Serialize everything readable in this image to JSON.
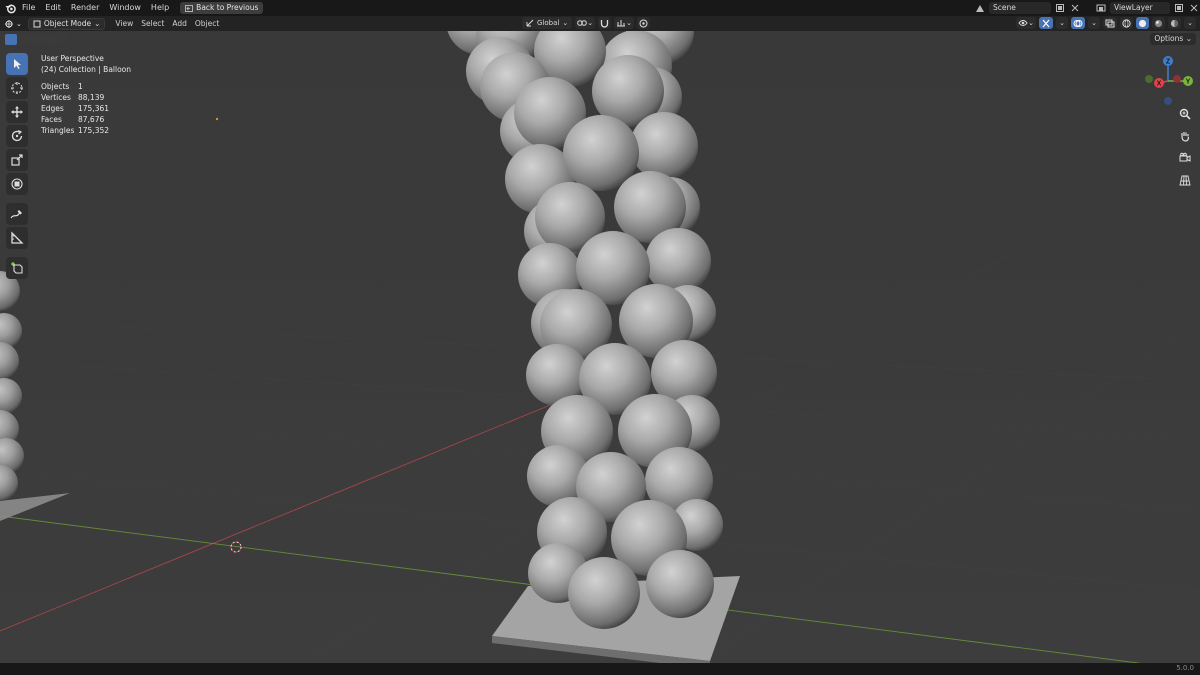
{
  "topbar": {
    "menus": [
      "File",
      "Edit",
      "Render",
      "Window",
      "Help"
    ],
    "back_button": "Back to Previous",
    "scene_label": "Scene",
    "view_layer_label": "ViewLayer"
  },
  "viewport_header": {
    "mode": "Object Mode",
    "menus": [
      "View",
      "Select",
      "Add",
      "Object"
    ],
    "orientation": "Global"
  },
  "tool_settings": {
    "options_label": "Options"
  },
  "overlay": {
    "view_name": "User Perspective",
    "collection": "(24) Collection | Balloon",
    "stats": [
      {
        "label": "Objects",
        "value": "1"
      },
      {
        "label": "Vertices",
        "value": "88,139"
      },
      {
        "label": "Edges",
        "value": "175,361"
      },
      {
        "label": "Faces",
        "value": "87,676"
      },
      {
        "label": "Triangles",
        "value": "175,352"
      }
    ]
  },
  "gizmo": {
    "x_label": "X",
    "y_label": "Y",
    "z_label": "Z"
  },
  "statusbar": {
    "version": "5.0.0"
  },
  "colors": {
    "accent": "#4772b3",
    "x_axis": "#e2424a",
    "y_axis": "#78b53a",
    "z_axis": "#3d7fd6",
    "viewport_bg": "#3a3a3a"
  }
}
